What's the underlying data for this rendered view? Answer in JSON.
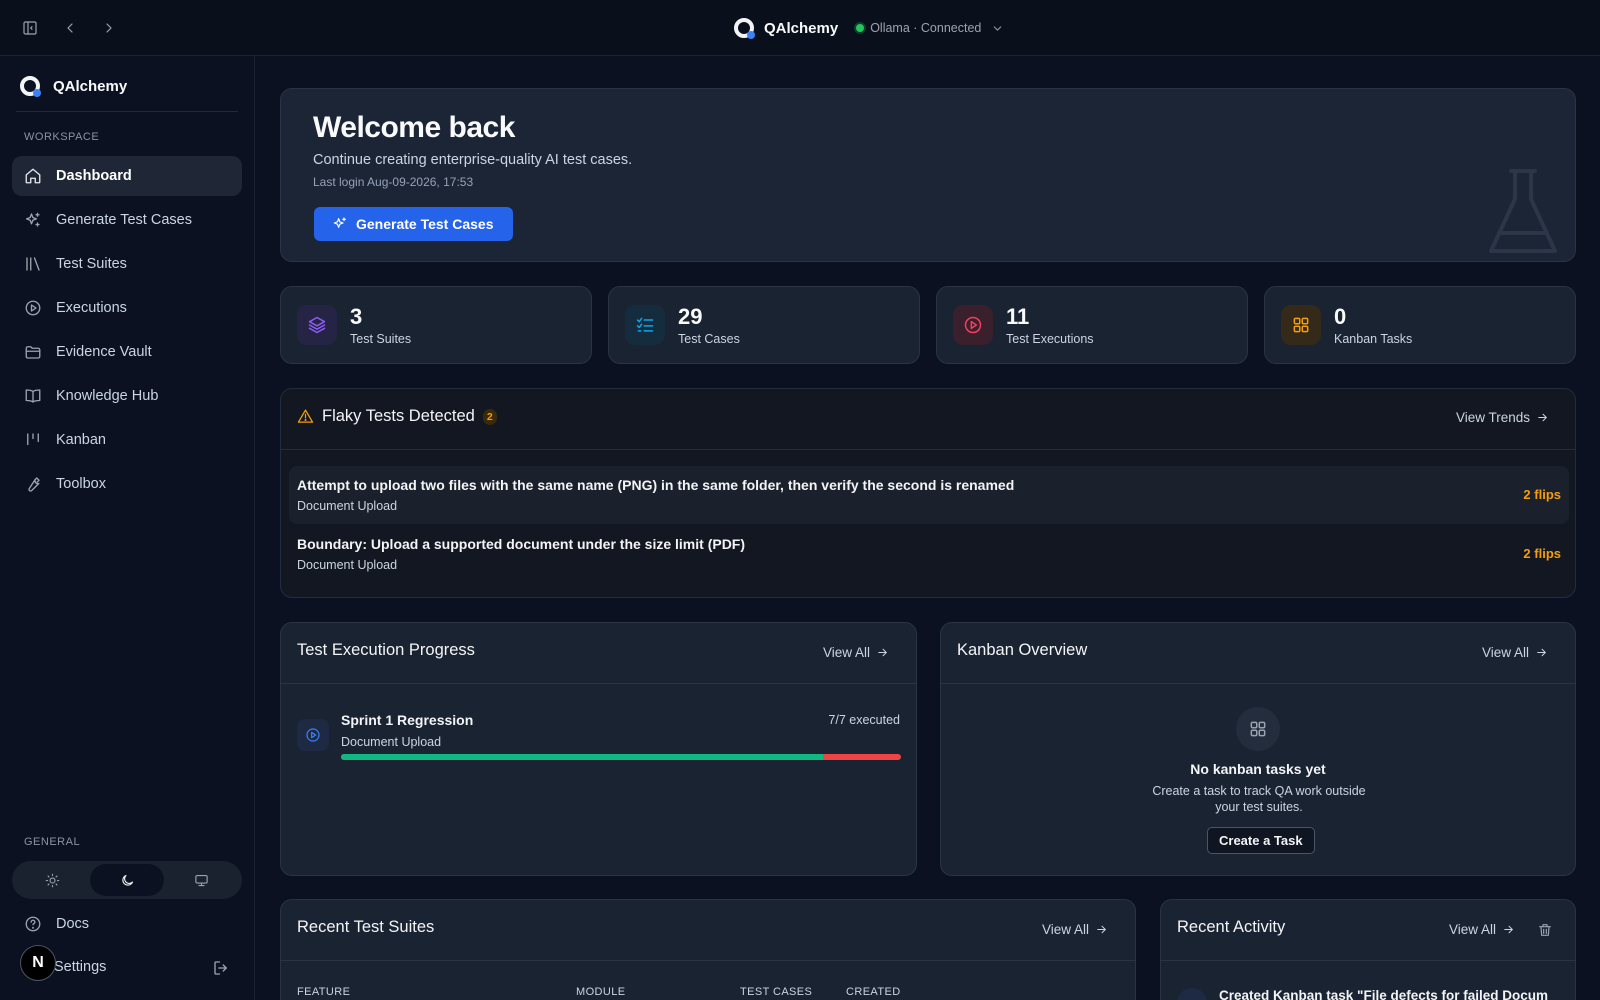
{
  "app": {
    "name": "QAlchemy",
    "status_label": "Ollama · Connected",
    "status_color": "#22c55e",
    "accent": "#2563eb"
  },
  "icons": {
    "sidebar_toggle": "sidebar-toggle-icon",
    "back": "chevron-left-icon",
    "forward": "chevron-right-icon",
    "dropdown": "chevron-down-icon"
  },
  "sidebar": {
    "brand": "QAlchemy",
    "workspace_label": "WORKSPACE",
    "items": [
      {
        "label": "Dashboard",
        "icon": "home-icon",
        "active": true
      },
      {
        "label": "Generate Test Cases",
        "icon": "sparkles-icon"
      },
      {
        "label": "Test Suites",
        "icon": "library-icon"
      },
      {
        "label": "Executions",
        "icon": "play-circle-icon"
      },
      {
        "label": "Evidence Vault",
        "icon": "folder-icon"
      },
      {
        "label": "Knowledge Hub",
        "icon": "book-icon"
      },
      {
        "label": "Kanban",
        "icon": "kanban-icon"
      },
      {
        "label": "Toolbox",
        "icon": "wrench-icon"
      }
    ],
    "general_label": "GENERAL",
    "theme_options": [
      "light",
      "dark",
      "system"
    ],
    "theme_active": "dark",
    "docs_label": "Docs",
    "settings_label": "Settings",
    "avatar_letter": "N"
  },
  "hero": {
    "title": "Welcome back",
    "subtitle": "Continue creating enterprise-quality AI test cases.",
    "last_login": "Last login Aug-09-2026, 17:53",
    "cta_label": "Generate Test Cases"
  },
  "stats": [
    {
      "value": "3",
      "label": "Test Suites",
      "icon": "layers-icon",
      "color": "#8b5cf6",
      "bg": "#262445"
    },
    {
      "value": "29",
      "label": "Test Cases",
      "icon": "list-checks-icon",
      "color": "#0ea5e9",
      "bg": "#152c3e"
    },
    {
      "value": "11",
      "label": "Test Executions",
      "icon": "play-circle-icon",
      "color": "#f43f5e",
      "bg": "#3a1f2c"
    },
    {
      "value": "0",
      "label": "Kanban Tasks",
      "icon": "grid-icon",
      "color": "#f59e0b",
      "bg": "#35291a"
    }
  ],
  "flaky": {
    "title": "Flaky Tests Detected",
    "count": "2",
    "view_label": "View Trends",
    "rows": [
      {
        "title": "Attempt to upload two files with the same name (PNG) in the same folder, then verify the second is renamed",
        "module": "Document Upload",
        "flips": "2 flips"
      },
      {
        "title": "Boundary: Upload a supported document under the size limit (PDF)",
        "module": "Document Upload",
        "flips": "2 flips"
      }
    ]
  },
  "execution": {
    "title": "Test Execution Progress",
    "view_label": "View All",
    "item": {
      "name": "Sprint 1 Regression",
      "module": "Document Upload",
      "count": "7/7 executed",
      "progress": 0.86
    }
  },
  "kanban": {
    "title": "Kanban Overview",
    "view_label": "View All",
    "empty_title": "No kanban tasks yet",
    "empty_subtitle": "Create a task to track QA work outside your test suites.",
    "cta_label": "Create a Task"
  },
  "recent_suites": {
    "title": "Recent Test Suites",
    "view_label": "View All",
    "columns": [
      "FEATURE",
      "MODULE",
      "TEST CASES",
      "CREATED"
    ]
  },
  "activity": {
    "title": "Recent Activity",
    "view_label": "View All",
    "first_item": "Created Kanban task \"File defects for failed Docum"
  }
}
